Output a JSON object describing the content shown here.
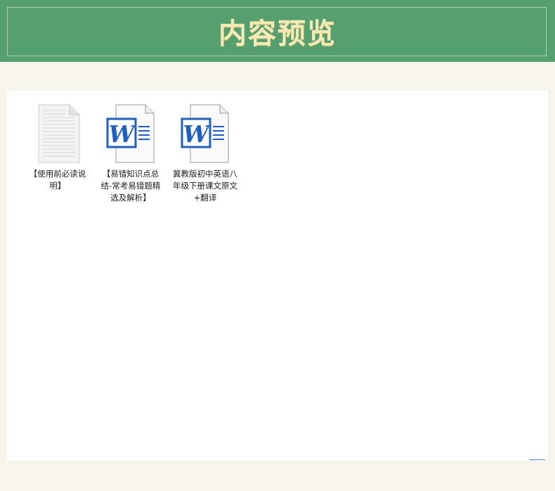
{
  "header": {
    "title": "内容预览"
  },
  "files": [
    {
      "name": "【使用前必读说明】",
      "icon": "text-document-icon"
    },
    {
      "name": "【易错知识点总结-常考易错题精选及解析】",
      "icon": "word-document-icon"
    },
    {
      "name": "冀教版初中英语八年级下册课文原文+翻译",
      "icon": "word-document-icon"
    }
  ],
  "colors": {
    "header_bg": "#56a070",
    "title": "#f6e9b5",
    "word_blue": "#1f5fbf",
    "page_bg": "#f6f3ec"
  }
}
